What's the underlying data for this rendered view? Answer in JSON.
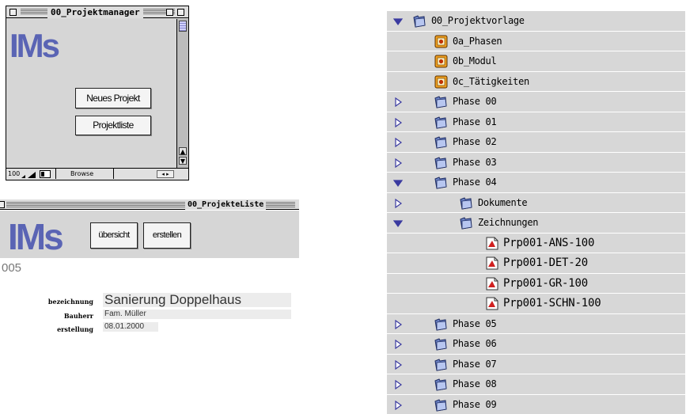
{
  "projektmanager": {
    "title": "00_Projektmanager",
    "logo_text": "IMs",
    "new_project_label": "Neues Projekt",
    "project_list_label": "Projektliste",
    "status": {
      "zoom": "100",
      "mode": "Browse"
    }
  },
  "projekteliste": {
    "title": "00_ProjekteListe",
    "logo_text": "IMs",
    "overview_label": "übersicht",
    "create_label": "erstellen",
    "project_number": "005",
    "fields": [
      {
        "label": "bezeichnung",
        "value": "Sanierung Doppelhaus"
      },
      {
        "label": "Bauherr",
        "value": "Fam. Müller"
      },
      {
        "label": "erstellung",
        "value": "08.01.2000"
      }
    ]
  },
  "tree": {
    "colors": {
      "folder": "#6f86c8",
      "row": "#d7d7d7",
      "expander": "#3a3aa0"
    },
    "items": [
      {
        "name": "00_Projektvorlage",
        "level": 0,
        "kind": "folder",
        "expander": "open"
      },
      {
        "name": "0a_Phasen",
        "level": 1,
        "kind": "db",
        "expander": "none"
      },
      {
        "name": "0b_Modul",
        "level": 1,
        "kind": "db",
        "expander": "none"
      },
      {
        "name": "0c_Tätigkeiten",
        "level": 1,
        "kind": "db",
        "expander": "none"
      },
      {
        "name": "Phase 00",
        "level": 1,
        "kind": "folder",
        "expander": "closed"
      },
      {
        "name": "Phase 01",
        "level": 1,
        "kind": "folder",
        "expander": "closed"
      },
      {
        "name": "Phase 02",
        "level": 1,
        "kind": "folder",
        "expander": "closed"
      },
      {
        "name": "Phase 03",
        "level": 1,
        "kind": "folder",
        "expander": "closed"
      },
      {
        "name": "Phase 04",
        "level": 1,
        "kind": "folder",
        "expander": "open"
      },
      {
        "name": "Dokumente",
        "level": 2,
        "kind": "folder",
        "expander": "closed"
      },
      {
        "name": "Zeichnungen",
        "level": 2,
        "kind": "folder",
        "expander": "open"
      },
      {
        "name": "Prp001-ANS-100",
        "level": 3,
        "kind": "file",
        "expander": "none"
      },
      {
        "name": "Prp001-DET-20",
        "level": 3,
        "kind": "file",
        "expander": "none"
      },
      {
        "name": "Prp001-GR-100",
        "level": 3,
        "kind": "file",
        "expander": "none"
      },
      {
        "name": "Prp001-SCHN-100",
        "level": 3,
        "kind": "file",
        "expander": "none"
      },
      {
        "name": "Phase 05",
        "level": 1,
        "kind": "folder",
        "expander": "closed"
      },
      {
        "name": "Phase 06",
        "level": 1,
        "kind": "folder",
        "expander": "closed"
      },
      {
        "name": "Phase 07",
        "level": 1,
        "kind": "folder",
        "expander": "closed"
      },
      {
        "name": "Phase 08",
        "level": 1,
        "kind": "folder",
        "expander": "closed"
      },
      {
        "name": "Phase 09",
        "level": 1,
        "kind": "folder",
        "expander": "closed"
      }
    ]
  }
}
